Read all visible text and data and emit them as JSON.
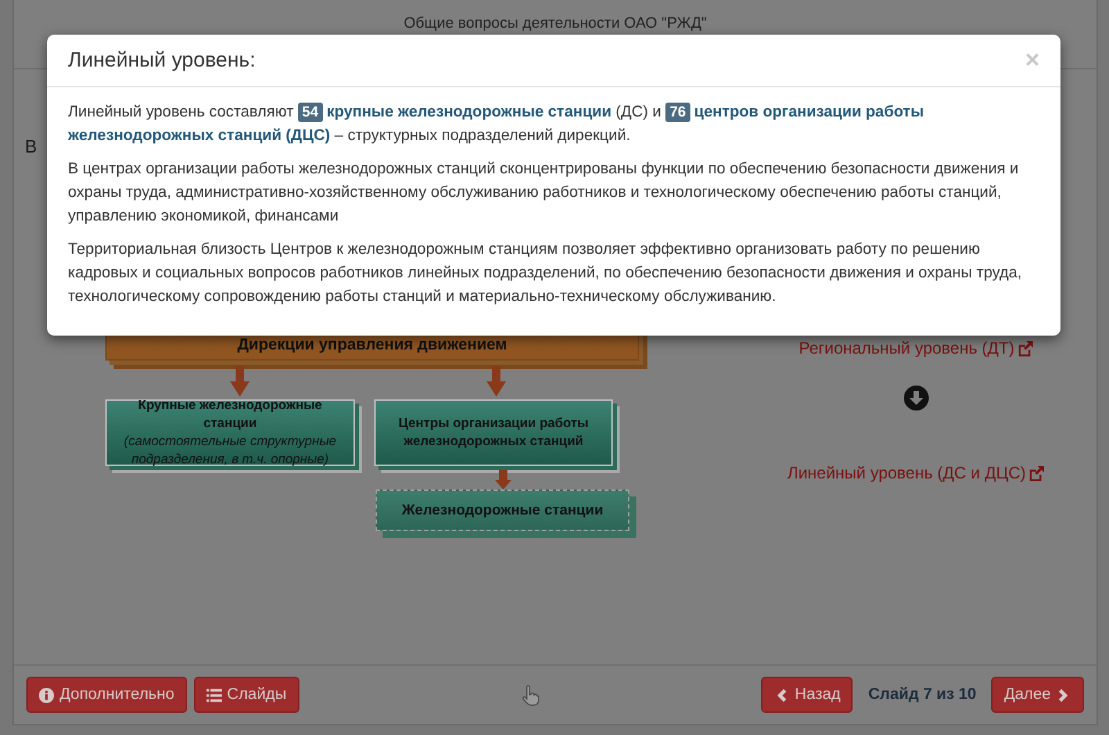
{
  "header": {
    "title": "Общие вопросы деятельности ОАО \"РЖД\""
  },
  "intro": "В",
  "diagram": {
    "top_box": "Дирекции управления движением",
    "boxes": [
      {
        "kind": "solid",
        "title": "Крупные железнодорожные станции",
        "note": "(самостоятельные структурные подразделения, в т.ч. опорные)"
      },
      {
        "kind": "solid",
        "title": "Центры организации работы железнодорожных станций"
      },
      {
        "kind": "dashed",
        "title": "Железнодорожные станции"
      }
    ]
  },
  "levels": [
    {
      "label": "Региональный уровень (ДТ)"
    },
    {
      "label": "Линейный уровень (ДС и ДЦС)"
    }
  ],
  "footer": {
    "more": "Дополнительно",
    "slides": "Слайды",
    "back": "Назад",
    "counter": "Слайд 7 из 10",
    "next": "Далее"
  },
  "modal": {
    "title": "Линейный уровень:",
    "close": "×",
    "lead": [
      {
        "kind": "text",
        "text": "Линейный уровень составляют "
      },
      {
        "kind": "badge",
        "text": "54"
      },
      {
        "kind": "strong",
        "text": "крупные железнодорожные станции"
      },
      {
        "kind": "text",
        "text": " (ДС) и "
      },
      {
        "kind": "badge",
        "text": "76"
      },
      {
        "kind": "strong",
        "text": "центров организации работы железнодорожных станций (ДЦС)"
      },
      {
        "kind": "text",
        "text": " – структурных подразделений дирекций."
      }
    ],
    "paragraphs": [
      "В центрах организации работы железнодорожных станций сконцентрированы функции по обеспечению безопасности движения и охраны труда, административно-хозяйственному обслуживанию работников и технологическому обеспечению работы станций, управлению экономикой, финансами",
      "Территориальная близость Центров к железнодорожным станциям позволяет эффективно организовать работу по решению кадровых и социальных вопросов работников линейных подразделений, по обеспечению безопасности движения и охраны труда, технологическому сопровождению работы станций и материально-техническому обслуживанию."
    ]
  }
}
